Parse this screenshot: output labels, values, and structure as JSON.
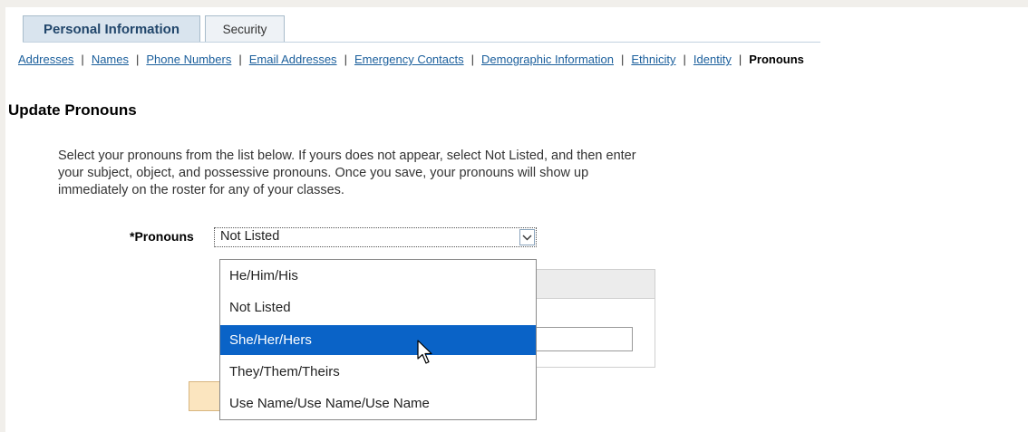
{
  "tabs": [
    {
      "label": "Personal Information",
      "active": true
    },
    {
      "label": "Security",
      "active": false
    }
  ],
  "subnav": {
    "links": [
      "Addresses",
      "Names",
      "Phone Numbers",
      "Email Addresses",
      "Emergency Contacts",
      "Demographic Information",
      "Ethnicity",
      "Identity"
    ],
    "current": "Pronouns",
    "separator": "|"
  },
  "page": {
    "heading": "Update Pronouns",
    "instructions_lines": [
      "Select your pronouns from the list below. If yours does not appear, select Not Listed, and then enter",
      "your subject, object, and possessive pronouns. Once you save, your pronouns will show up",
      "immediately on the roster for any of your classes."
    ]
  },
  "pronouns_field": {
    "label": "*Pronouns",
    "value": "Not Listed",
    "options": [
      {
        "label": "He/Him/His",
        "selected": false
      },
      {
        "label": "Not Listed",
        "selected": false
      },
      {
        "label": "She/Her/Hers",
        "selected": true
      },
      {
        "label": "They/Them/Theirs",
        "selected": false
      },
      {
        "label": "Use Name/Use Name/Use Name",
        "selected": false
      }
    ]
  },
  "icons": {
    "dropdown": "chevron-down-icon",
    "cursor": "mouse-pointer-icon"
  },
  "colors": {
    "link": "#1b5f9c",
    "highlight": "#0a63c7",
    "tab_active_bg": "#d9e4ee",
    "tab_text": "#21466b"
  }
}
